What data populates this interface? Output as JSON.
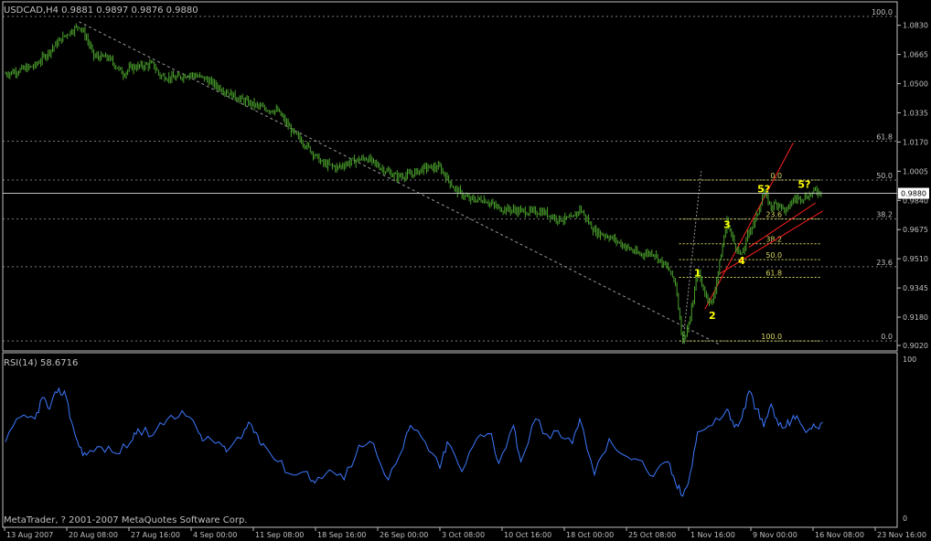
{
  "window": {
    "header": "USDCAD,H4  0.9881 0.9897 0.9876 0.9880",
    "copyright": "MetaTrader, ? 2001-2007 MetaQuotes Software Corp."
  },
  "colors": {
    "background": "#000000",
    "bars": "#4aa02c",
    "rsi": "#3c78ff",
    "axis": "#c0c0c0",
    "text": "#c0c0c0",
    "grid": "#7a7a7a",
    "fib": "#d8d860",
    "channel": "#ff2020",
    "waves": "#ffff00",
    "trend": "#9a9a9a"
  },
  "chart_data": [
    {
      "type": "ohlc",
      "symbol": "USDCAD",
      "timeframe": "H4",
      "last_price": "0.9880",
      "ylim": [
        0.902,
        1.088
      ],
      "y_ticks": [
        "1.0830",
        "1.0665",
        "1.0500",
        "1.0335",
        "1.0170",
        "1.0005",
        "0.9840",
        "0.9675",
        "0.9510",
        "0.9345",
        "0.9180",
        "0.9020"
      ],
      "x_ticks": [
        "13 Aug 2007",
        "20 Aug 08:00",
        "27 Aug 16:00",
        "4 Sep 00:00",
        "11 Sep 08:00",
        "18 Sep 16:00",
        "26 Sep 00:00",
        "3 Oct 08:00",
        "10 Oct 16:00",
        "18 Oct 00:00",
        "25 Oct 08:00",
        "1 Nov 16:00",
        "9 Nov 00:00",
        "16 Nov 08:00",
        "23 Nov 16:00"
      ],
      "close_path": [
        [
          0,
          1.0555
        ],
        [
          4,
          1.06
        ],
        [
          8,
          1.077
        ],
        [
          10,
          1.083
        ],
        [
          11,
          1.076
        ],
        [
          12,
          1.0655
        ],
        [
          14,
          1.0645
        ],
        [
          16,
          1.0555
        ],
        [
          17,
          1.059
        ],
        [
          20,
          1.061
        ],
        [
          21,
          1.0545
        ],
        [
          23,
          1.053
        ],
        [
          25,
          1.0555
        ],
        [
          27,
          1.053
        ],
        [
          30,
          1.0455
        ],
        [
          32,
          1.041
        ],
        [
          35,
          1.036
        ],
        [
          37,
          1.0345
        ],
        [
          39,
          1.0225
        ],
        [
          41,
          1.0145
        ],
        [
          43,
          1.005
        ],
        [
          45,
          1.0025
        ],
        [
          47,
          1.006
        ],
        [
          49,
          1.008
        ],
        [
          51,
          1.0025
        ],
        [
          53,
          0.9975
        ],
        [
          55,
          0.9985
        ],
        [
          57,
          1.0025
        ],
        [
          59,
          1.0025
        ],
        [
          61,
          0.9905
        ],
        [
          63,
          0.9845
        ],
        [
          65,
          0.9845
        ],
        [
          67,
          0.9795
        ],
        [
          69,
          0.9785
        ],
        [
          71,
          0.9775
        ],
        [
          73,
          0.9775
        ],
        [
          75,
          0.9735
        ],
        [
          77,
          0.9735
        ],
        [
          78,
          0.9795
        ],
        [
          80,
          0.9665
        ],
        [
          82,
          0.9635
        ],
        [
          84,
          0.9585
        ],
        [
          86,
          0.9535
        ],
        [
          88,
          0.9545
        ],
        [
          89,
          0.9495
        ],
        [
          90,
          0.9455
        ],
        [
          91,
          0.9375
        ],
        [
          92,
          0.9045
        ],
        [
          93,
          0.9165
        ],
        [
          94,
          0.9445
        ],
        [
          95,
          0.9315
        ],
        [
          96,
          0.9255
        ],
        [
          97,
          0.9485
        ],
        [
          98,
          0.9725
        ],
        [
          99,
          0.9595
        ],
        [
          100,
          0.9525
        ],
        [
          101,
          0.9665
        ],
        [
          102,
          0.9745
        ],
        [
          103,
          0.9885
        ],
        [
          104,
          0.9805
        ],
        [
          105,
          0.9825
        ],
        [
          106,
          0.9775
        ],
        [
          107,
          0.9845
        ],
        [
          108,
          0.9855
        ],
        [
          109,
          0.9865
        ],
        [
          110,
          0.9895
        ],
        [
          111,
          0.988
        ]
      ],
      "fibonacci": {
        "main_levels": [
          {
            "label": "100.0",
            "value": 1.088
          },
          {
            "label": "61.8",
            "value": 1.0175
          },
          {
            "label": "50.0",
            "value": 0.9955
          },
          {
            "label": "38.2",
            "value": 0.9735
          },
          {
            "label": "23.6",
            "value": 0.9465
          },
          {
            "label": "0.0",
            "value": 0.9045
          }
        ],
        "small_levels": [
          {
            "label": "0.0",
            "value": 0.9955
          },
          {
            "label": "23.6",
            "value": 0.9735
          },
          {
            "label": "38.2",
            "value": 0.9595
          },
          {
            "label": "50.0",
            "value": 0.9505
          },
          {
            "label": "61.8",
            "value": 0.9405
          },
          {
            "label": "100.0",
            "value": 0.9045
          }
        ]
      },
      "wave_labels": [
        {
          "text": "1",
          "x": 94,
          "y": 0.941
        },
        {
          "text": "2",
          "x": 96,
          "y": 0.917
        },
        {
          "text": "3",
          "x": 98,
          "y": 0.9685
        },
        {
          "text": "4",
          "x": 100,
          "y": 0.948
        },
        {
          "text": "5?",
          "x": 103,
          "y": 0.9885
        },
        {
          "text": "5?",
          "x": 108.5,
          "y": 0.991
        }
      ]
    },
    {
      "type": "line",
      "indicator": "RSI",
      "header": "RSI(14) 58.6716",
      "ylim": [
        0,
        100
      ],
      "y_ticks": [
        "100",
        "0"
      ],
      "series": [
        {
          "x": [
            0,
            2,
            4,
            5,
            6,
            7,
            8,
            9,
            10,
            11,
            13,
            15,
            17,
            18,
            20,
            22,
            24,
            26,
            27,
            29,
            30,
            32,
            33,
            34,
            35,
            37,
            39,
            41,
            42,
            44,
            46,
            48,
            50,
            52,
            54,
            55,
            57,
            59,
            60,
            62,
            64,
            66,
            67,
            69,
            70,
            72,
            74,
            75,
            77,
            78,
            80,
            82,
            84,
            86,
            88,
            90,
            91,
            92,
            93,
            94,
            96,
            98,
            99,
            100,
            101,
            102,
            103,
            104,
            105,
            106,
            107,
            108,
            109,
            110,
            111
          ],
          "y": [
            48,
            63,
            62,
            75,
            68,
            78,
            79,
            60,
            45,
            40,
            45,
            41,
            48,
            56,
            52,
            62,
            67,
            56,
            49,
            48,
            42,
            50,
            60,
            54,
            47,
            36,
            28,
            30,
            23,
            31,
            25,
            46,
            47,
            25,
            44,
            58,
            48,
            32,
            48,
            30,
            50,
            53,
            35,
            58,
            36,
            62,
            50,
            55,
            47,
            62,
            28,
            50,
            40,
            37,
            27,
            36,
            23,
            15,
            29,
            54,
            58,
            68,
            57,
            62,
            79,
            68,
            57,
            71,
            58,
            57,
            64,
            59,
            55,
            57,
            60
          ]
        }
      ]
    }
  ]
}
